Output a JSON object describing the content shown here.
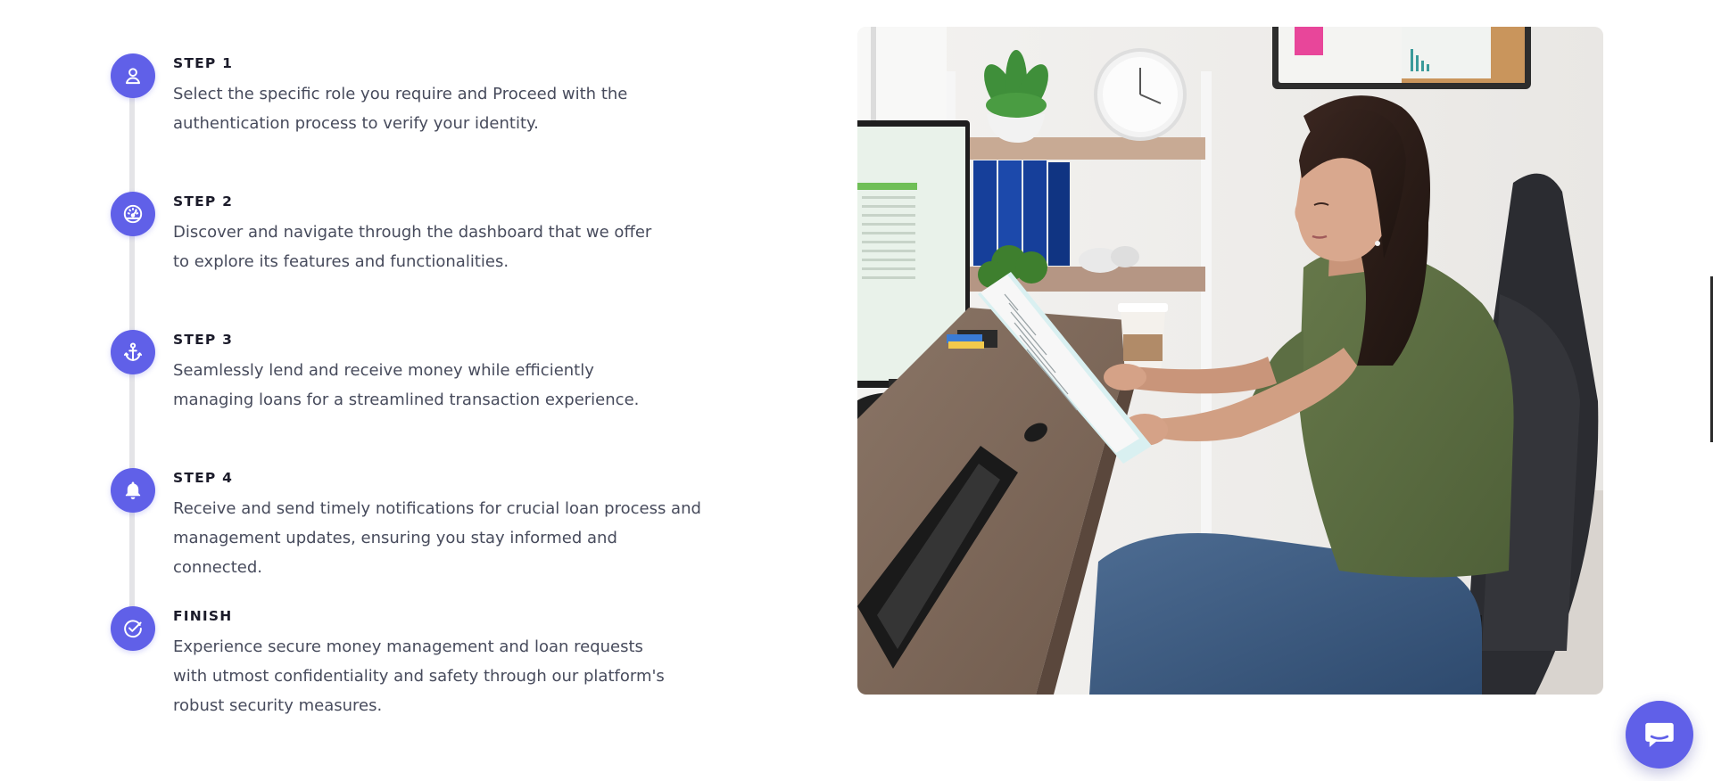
{
  "theme": {
    "accent": "#6060e8",
    "timeline": "#e4e4e7",
    "title_color": "#1b1b2a",
    "text_color": "#474b5c"
  },
  "steps": [
    {
      "title": "STEP 1",
      "icon": "user-icon",
      "description": "Select the specific role you require and Proceed with the authentication process to verify your identity."
    },
    {
      "title": "STEP 2",
      "icon": "speedometer-icon",
      "description": "Discover and navigate through the dashboard that we offer to explore its features and functionalities."
    },
    {
      "title": "STEP 3",
      "icon": "anchor-icon",
      "description": "Seamlessly lend and receive money while efficiently managing loans for a streamlined transaction experience."
    },
    {
      "title": "STEP 4",
      "icon": "bell-icon",
      "description": "Receive and send timely notifications for crucial loan process and management updates, ensuring you stay informed and connected."
    },
    {
      "title": "FINISH",
      "icon": "check-circle-icon",
      "description": "Experience secure money management and loan requests with utmost confidentiality and safety through our platform's robust security measures."
    }
  ],
  "photo": {
    "subject": "woman-reading-document-at-desk"
  },
  "chat": {
    "icon": "chat-bubble-icon"
  }
}
